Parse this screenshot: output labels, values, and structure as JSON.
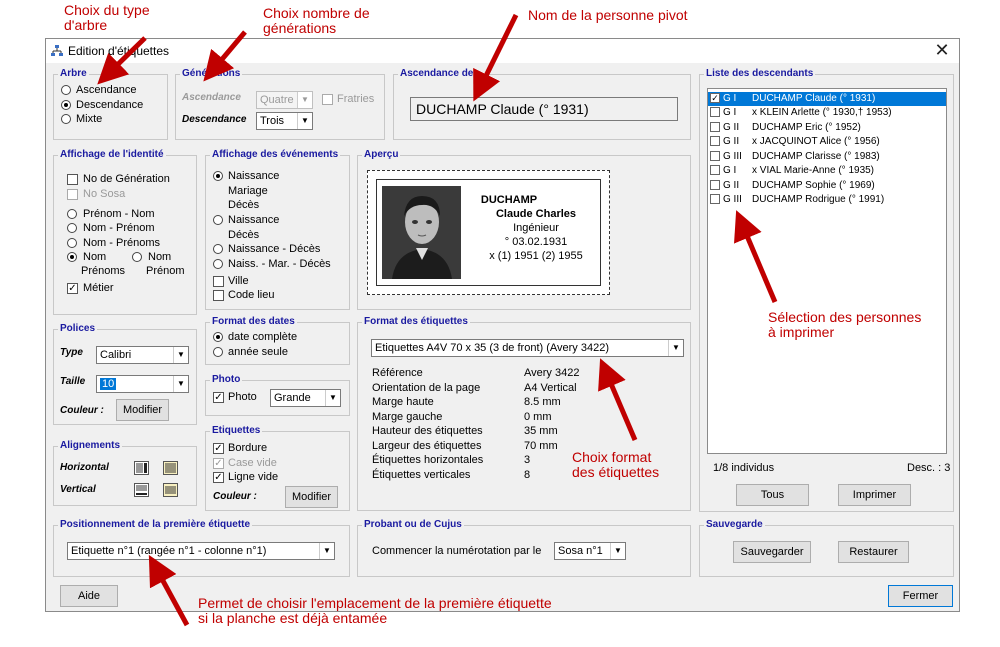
{
  "window": {
    "title": "Edition d'étiquettes",
    "close_glyph": "✕"
  },
  "annotations": {
    "tree_type": "Choix du type\nd'arbre",
    "generations": "Choix nombre de\ngénérations",
    "pivot": "Nom de la personne pivot",
    "selection": "Sélection des personnes\nà imprimer",
    "format": "Choix format\ndes étiquettes",
    "first_label": "Permet de choisir l'emplacement de la première étiquette\nsi la planche est déjà entamée"
  },
  "arbre": {
    "title": "Arbre",
    "options": [
      "Ascendance",
      "Descendance",
      "Mixte"
    ],
    "selected": 1
  },
  "generations": {
    "title": "Générations",
    "asc_label": "Ascendance",
    "asc_value": "Quatre",
    "fratries_label": "Fratries",
    "desc_label": "Descendance",
    "desc_value": "Trois"
  },
  "ascendance": {
    "title": "Ascendance de",
    "person": "DUCHAMP Claude  (° 1931)"
  },
  "descendants": {
    "title": "Liste des descendants",
    "items": [
      {
        "gen": "G I",
        "name": "DUCHAMP Claude  (° 1931)",
        "checked": true
      },
      {
        "gen": "G I",
        "name": "x KLEIN Arlette  (° 1930,† 1953)",
        "checked": false
      },
      {
        "gen": "G II",
        "name": "DUCHAMP Eric  (° 1952)",
        "checked": false
      },
      {
        "gen": "G II",
        "name": "x JACQUINOT Alice  (° 1956)",
        "checked": false
      },
      {
        "gen": "G III",
        "name": "DUCHAMP Clarisse  (° 1983)",
        "checked": false
      },
      {
        "gen": "G I",
        "name": "x VIAL Marie-Anne  (° 1935)",
        "checked": false
      },
      {
        "gen": "G II",
        "name": "DUCHAMP Sophie  (° 1969)",
        "checked": false
      },
      {
        "gen": "G III",
        "name": "DUCHAMP Rodrigue  (° 1991)",
        "checked": false
      }
    ],
    "count": "1/8 individus",
    "sort": "Desc. : 3",
    "all_button": "Tous",
    "print_button": "Imprimer"
  },
  "identite": {
    "title": "Affichage de l'identité",
    "no_generation": "No de Génération",
    "no_sosa": "No Sosa",
    "formats": [
      "Prénom - Nom",
      "Nom - Prénom",
      "Nom - Prénoms"
    ],
    "nom_prenoms_a": "Nom",
    "nom_prenoms_b": "Prénoms",
    "nom_prenom_a": "Nom",
    "nom_prenom_b": "Prénom",
    "metier": "Métier"
  },
  "evenements": {
    "title": "Affichage des événements",
    "options": [
      "Naissance",
      "Mariage",
      "Décès",
      "Naissance",
      "Décès",
      "Naissance - Décès",
      "Naiss. -  Mar. -  Décès"
    ],
    "ville": "Ville",
    "code_lieu": "Code lieu"
  },
  "apercu": {
    "title": "Aperçu",
    "name": "DUCHAMP",
    "firstnames": "Claude Charles",
    "job": "Ingénieur",
    "birth": "° 03.02.1931",
    "marriage": "x (1) 1951 (2) 1955"
  },
  "polices": {
    "title": "Polices",
    "type_label": "Type",
    "type_value": "Calibri",
    "size_label": "Taille",
    "size_value": "10",
    "color_label": "Couleur :",
    "modify": "Modifier"
  },
  "alignements": {
    "title": "Alignements",
    "horizontal": "Horizontal",
    "vertical": "Vertical"
  },
  "format_dates": {
    "title": "Format des dates",
    "options": [
      "date complète",
      "année seule"
    ]
  },
  "photo": {
    "title": "Photo",
    "label": "Photo",
    "size": "Grande"
  },
  "etiquettes": {
    "title": "Etiquettes",
    "bordure": "Bordure",
    "case_vide": "Case vide",
    "ligne_vide": "Ligne vide",
    "color_label": "Couleur :",
    "modify": "Modifier"
  },
  "format_etiquettes": {
    "title": "Format des étiquettes",
    "selected": "Etiquettes A4V 70 x 35 (3 de front) (Avery 3422)",
    "rows": [
      {
        "k": "Référence",
        "v": "Avery 3422"
      },
      {
        "k": "Orientation de la page",
        "v": "A4 Vertical"
      },
      {
        "k": "Marge haute",
        "v": "8.5 mm"
      },
      {
        "k": "Marge gauche",
        "v": "0 mm"
      },
      {
        "k": "Hauteur des étiquettes",
        "v": "35 mm"
      },
      {
        "k": "Largeur des étiquettes",
        "v": "70 mm"
      },
      {
        "k": "Étiquettes horizontales",
        "v": "3"
      },
      {
        "k": "Étiquettes verticales",
        "v": "8"
      }
    ]
  },
  "positionnement": {
    "title": "Positionnement de la première étiquette",
    "value": "Etiquette n°1 (rangée n°1 - colonne n°1)"
  },
  "probant": {
    "title": "Probant ou de Cujus",
    "label": "Commencer la numérotation par le",
    "value": "Sosa n°1"
  },
  "sauvegarde": {
    "title": "Sauvegarde",
    "save": "Sauvegarder",
    "restore": "Restaurer"
  },
  "footer": {
    "help": "Aide",
    "close": "Fermer"
  },
  "colors": {
    "annotation": "#c00000",
    "group_title": "#1a1aa0",
    "selection": "#0078d7"
  }
}
